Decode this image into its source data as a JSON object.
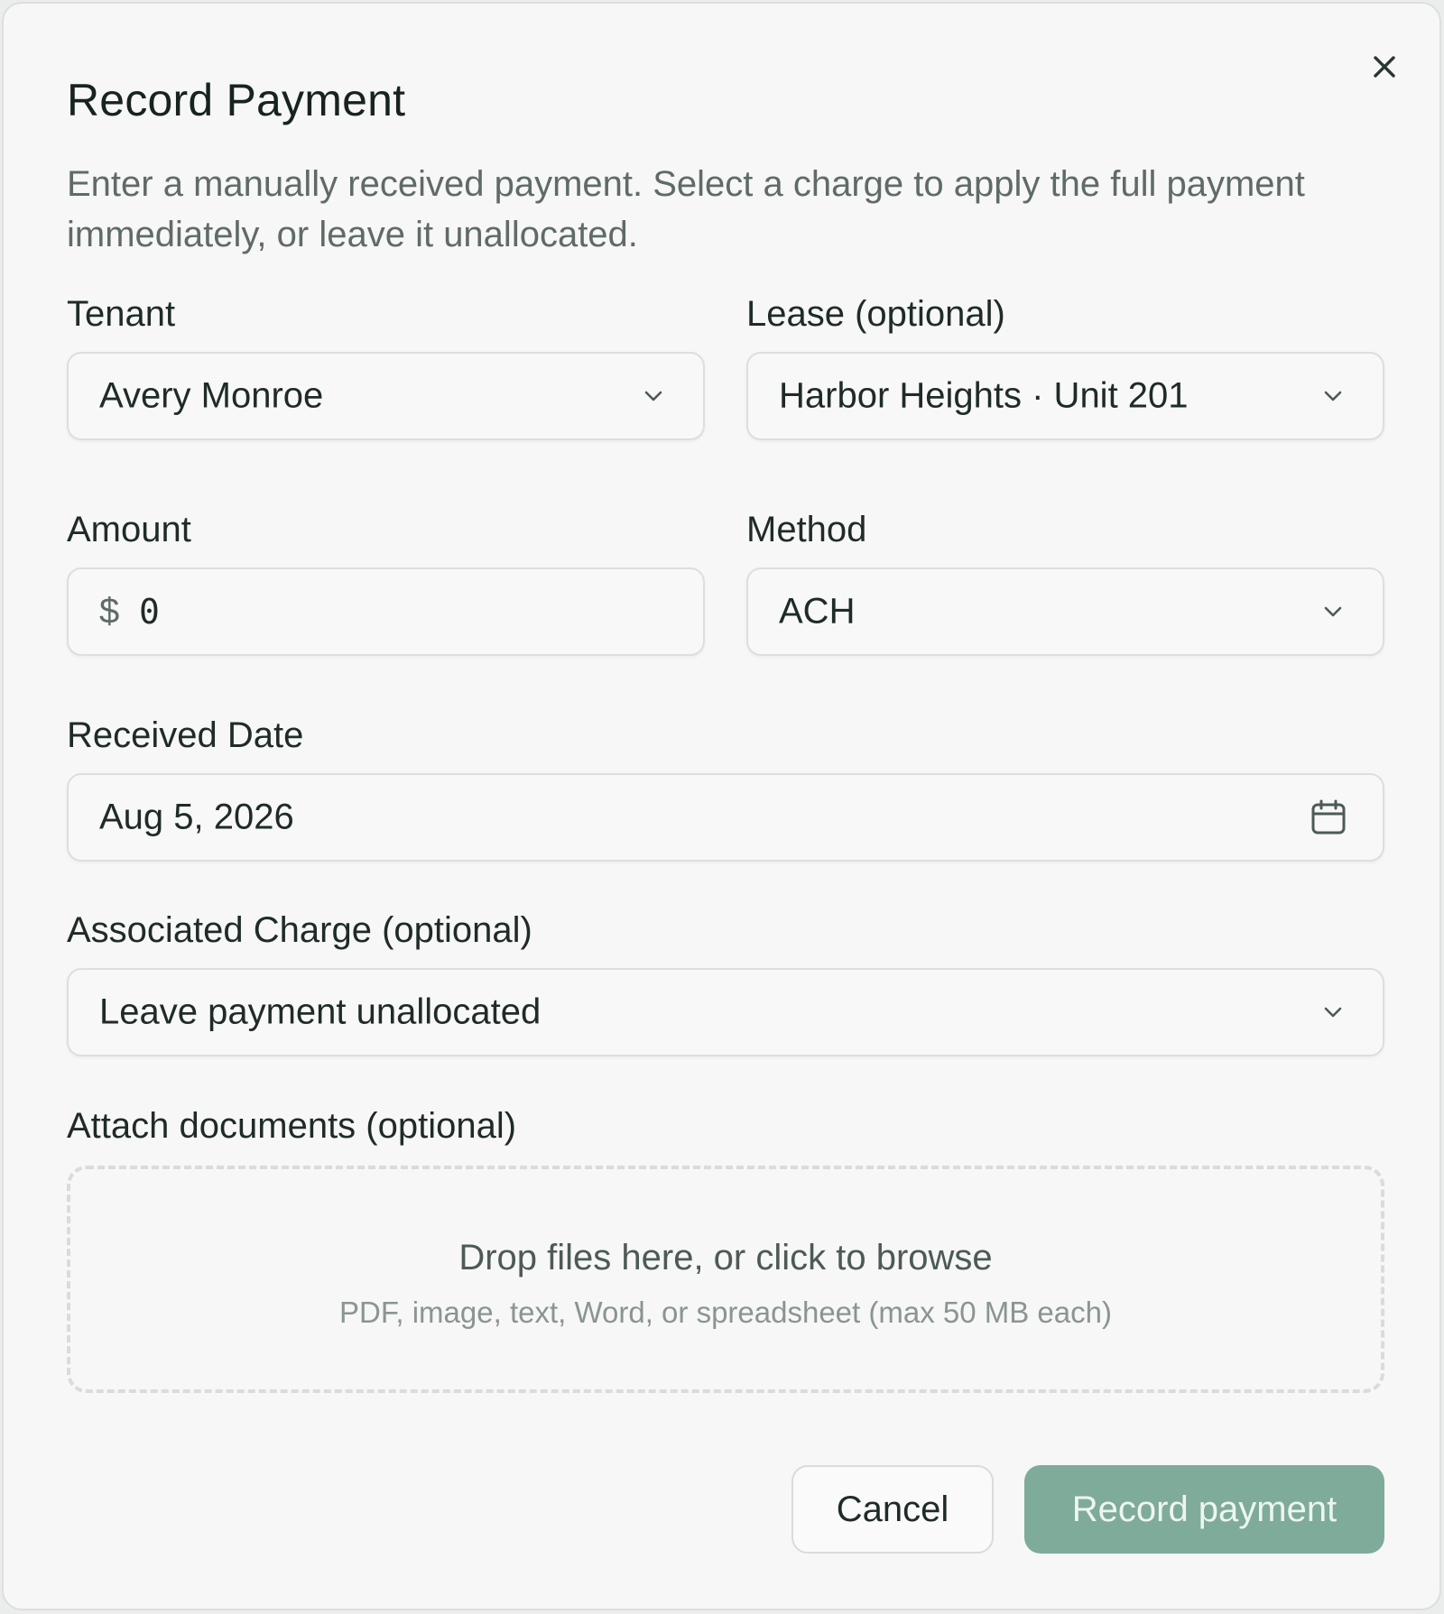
{
  "dialog": {
    "title": "Record Payment",
    "description": "Enter a manually received payment. Select a charge to apply the full payment immediately, or leave it unallocated.",
    "close_icon": "close-icon"
  },
  "form": {
    "tenant": {
      "label": "Tenant",
      "value": "Avery Monroe"
    },
    "lease": {
      "label": "Lease (optional)",
      "value": "Harbor Heights · Unit 201"
    },
    "amount": {
      "label": "Amount",
      "currency_symbol": "$",
      "value": "0"
    },
    "method": {
      "label": "Method",
      "value": "ACH"
    },
    "received_date": {
      "label": "Received Date",
      "value": "Aug 5, 2026",
      "icon": "calendar-icon"
    },
    "associated_charge": {
      "label": "Associated Charge (optional)",
      "value": "Leave payment unallocated"
    },
    "attachments": {
      "label": "Attach documents (optional)",
      "drop_title": "Drop files here, or click to browse",
      "drop_hint": "PDF, image, text, Word, or spreadsheet (max 50 MB each)"
    }
  },
  "actions": {
    "cancel_label": "Cancel",
    "submit_label": "Record payment"
  },
  "colors": {
    "accent": "#7fab9a",
    "text": "#1f2b27",
    "muted_text": "#5f6b67",
    "border": "#dcdfdd",
    "background": "#f6f7f6"
  }
}
